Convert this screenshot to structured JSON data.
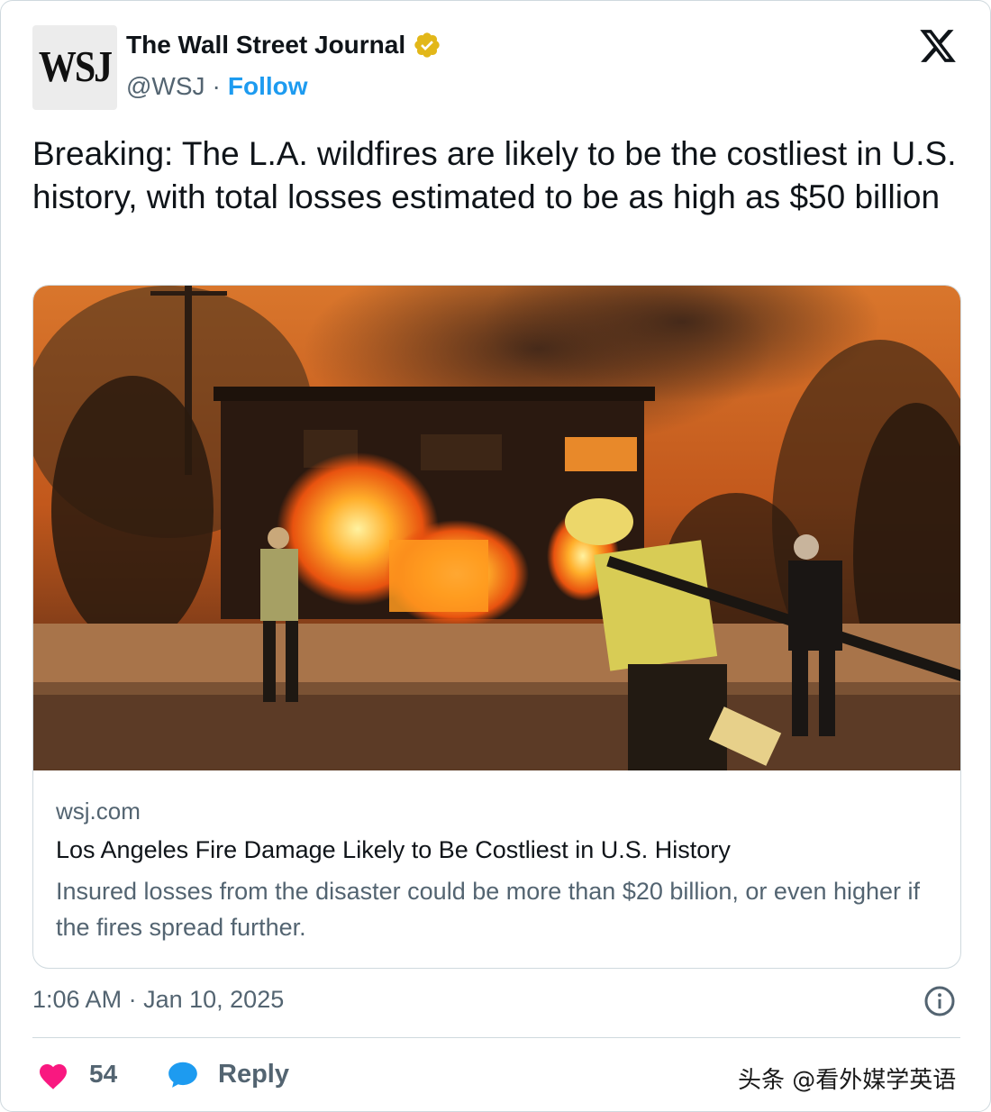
{
  "author": {
    "avatar_text": "WSJ",
    "name": "The Wall Street Journal",
    "handle": "@WSJ",
    "separator": "·",
    "follow_label": "Follow"
  },
  "tweet": {
    "text": "Breaking: The L.A. wildfires are likely to be the costliest in U.S. history, with total losses estimated to be as high as $50 billion"
  },
  "link_card": {
    "domain": "wsj.com",
    "headline": "Los Angeles Fire Damage Likely to Be Costliest in U.S. History",
    "description": "Insured losses from the disaster could be more than $20 billion, or even higher if the fires spread further."
  },
  "meta": {
    "time": "1:06 AM",
    "separator": "·",
    "date": "Jan 10, 2025"
  },
  "actions": {
    "like_count": "54",
    "reply_label": "Reply"
  },
  "watermark": "头条 @看外媒学英语",
  "icons": {
    "verified": "verified-badge-icon",
    "platform": "x-logo-icon",
    "info": "info-icon",
    "like": "heart-icon",
    "reply": "reply-bubble-icon"
  },
  "colors": {
    "accent": "#1d9bf0",
    "verified": "#e2b719",
    "heart": "#f91880",
    "secondary_text": "#536471",
    "border": "#cfd9de"
  }
}
